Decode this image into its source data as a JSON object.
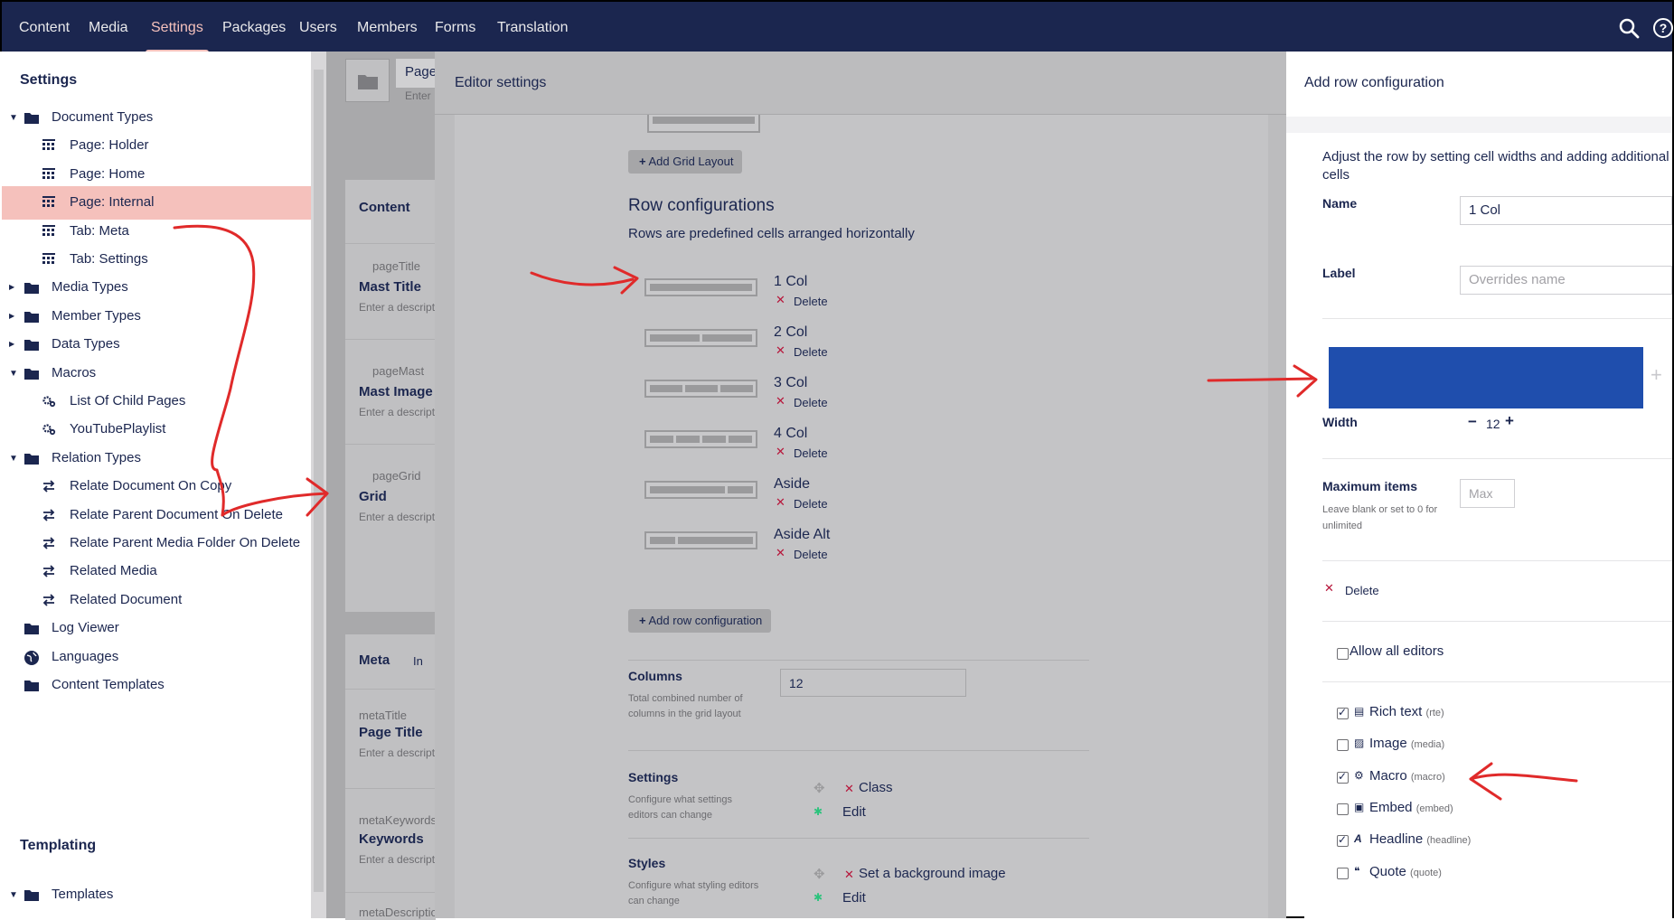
{
  "nav": {
    "items": [
      "Content",
      "Media",
      "Settings",
      "Packages",
      "Users",
      "Members",
      "Forms",
      "Translation"
    ],
    "active": "Settings"
  },
  "tree": {
    "section_settings": "Settings",
    "items": [
      {
        "label": "Document Types",
        "icon": "folder-icon",
        "level": 0,
        "expanded": true
      },
      {
        "label": "Page: Holder",
        "icon": "grid-icon",
        "level": 1
      },
      {
        "label": "Page: Home",
        "icon": "grid-icon",
        "level": 1
      },
      {
        "label": "Page: Internal",
        "icon": "grid-icon",
        "level": 1,
        "selected": true
      },
      {
        "label": "Tab: Meta",
        "icon": "grid-icon",
        "level": 1
      },
      {
        "label": "Tab: Settings",
        "icon": "grid-icon",
        "level": 1
      },
      {
        "label": "Media Types",
        "icon": "folder-icon",
        "level": 0,
        "expanded": false
      },
      {
        "label": "Member Types",
        "icon": "folder-icon",
        "level": 0,
        "expanded": false
      },
      {
        "label": "Data Types",
        "icon": "folder-icon",
        "level": 0,
        "expanded": false
      },
      {
        "label": "Macros",
        "icon": "folder-icon",
        "level": 0,
        "expanded": true
      },
      {
        "label": "List Of Child Pages",
        "icon": "gears-icon",
        "level": 1
      },
      {
        "label": "YouTubePlaylist",
        "icon": "gears-icon",
        "level": 1
      },
      {
        "label": "Relation Types",
        "icon": "folder-icon",
        "level": 0,
        "expanded": true
      },
      {
        "label": "Relate Document On Copy",
        "icon": "swap-icon",
        "level": 1
      },
      {
        "label": "Relate Parent Document On Delete",
        "icon": "swap-icon",
        "level": 1
      },
      {
        "label": "Relate Parent Media Folder On Delete",
        "icon": "swap-icon",
        "level": 1
      },
      {
        "label": "Related Media",
        "icon": "swap-icon",
        "level": 1
      },
      {
        "label": "Related Document",
        "icon": "swap-icon",
        "level": 1
      },
      {
        "label": "Log Viewer",
        "icon": "folder-icon",
        "level": 0
      },
      {
        "label": "Languages",
        "icon": "globe-icon",
        "level": 0
      },
      {
        "label": "Content Templates",
        "icon": "folder-icon",
        "level": 0
      }
    ],
    "section_templating": "Templating",
    "templates": "Templates"
  },
  "doc": {
    "name_partial": "Page",
    "desc_partial": "Enter",
    "content_group": "Content",
    "properties": [
      {
        "alias": "pageTitle",
        "name": "Mast Title",
        "desc": "Enter a descript"
      },
      {
        "alias": "pageMast",
        "name": "Mast Image",
        "desc": "Enter a descript"
      },
      {
        "alias": "pageGrid",
        "name": "Grid",
        "desc": "Enter a descript"
      }
    ],
    "meta_group": "Meta",
    "meta_inherit": "In",
    "meta_properties": [
      {
        "alias": "metaTitle",
        "name": "Page Title",
        "desc": "Enter a descript"
      },
      {
        "alias": "metaKeywords",
        "name": "Keywords",
        "desc": "Enter a descript"
      },
      {
        "alias": "metaDescriptio",
        "name": "",
        "desc": ""
      }
    ]
  },
  "editor": {
    "title": "Editor settings",
    "add_grid_layout": "Add Grid Layout",
    "row_config_heading": "Row configurations",
    "row_config_desc": "Rows are predefined cells arranged horizontally",
    "delete_label": "Delete",
    "rows": [
      "1 Col",
      "2 Col",
      "3 Col",
      "4 Col",
      "Aside",
      "Aside Alt"
    ],
    "add_row_configuration": "Add row configuration",
    "columns_label": "Columns",
    "columns_desc": "Total combined number of columns in the grid layout",
    "columns_value": "12",
    "settings_label": "Settings",
    "settings_desc": "Configure what settings editors can change",
    "settings_item": "Class",
    "edit_label": "Edit",
    "styles_label": "Styles",
    "styles_desc": "Configure what styling editors can change",
    "styles_item": "Set a background image"
  },
  "row_panel": {
    "title": "Add row configuration",
    "intro": "Adjust the row by setting cell widths and adding additional cells",
    "name_label": "Name",
    "name_value": "1 Col",
    "label_label": "Label",
    "label_placeholder": "Overrides name",
    "width_label": "Width",
    "width_value": "12",
    "max_items_label": "Maximum items",
    "max_items_desc": "Leave blank or set to 0 for unlimited",
    "max_placeholder": "Max",
    "delete_label": "Delete",
    "allow_all_editors": "Allow all editors",
    "allow_all_checked": false,
    "editors": [
      {
        "name": "Rich text",
        "alias": "(rte)",
        "checked": true,
        "icon": "rte-icon"
      },
      {
        "name": "Image",
        "alias": "(media)",
        "checked": false,
        "icon": "image-icon"
      },
      {
        "name": "Macro",
        "alias": "(macro)",
        "checked": true,
        "icon": "macro-icon"
      },
      {
        "name": "Embed",
        "alias": "(embed)",
        "checked": false,
        "icon": "embed-icon"
      },
      {
        "name": "Headline",
        "alias": "(headline)",
        "checked": true,
        "icon": "headline-icon"
      },
      {
        "name": "Quote",
        "alias": "(quote)",
        "checked": false,
        "icon": "quote-icon"
      }
    ],
    "cell_color": "#1f4ead"
  },
  "colors": {
    "nav_bg": "#1b264f",
    "accent": "#f5c1bc",
    "annotation": "#e02a2a"
  }
}
